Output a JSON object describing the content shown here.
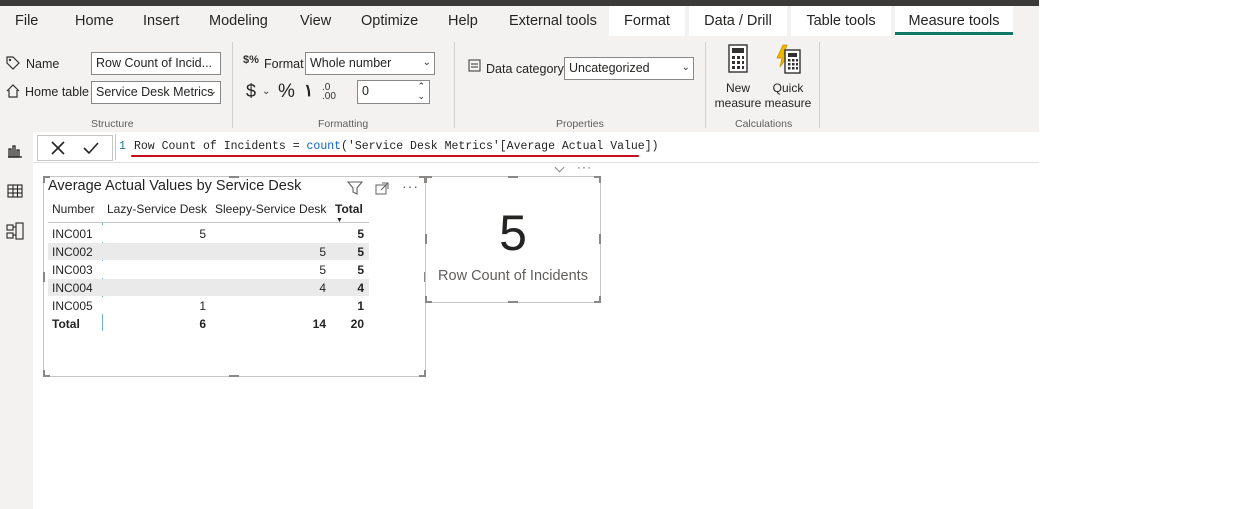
{
  "ribbon_tabs": [
    "File",
    "Home",
    "Insert",
    "Modeling",
    "View",
    "Optimize",
    "Help",
    "External tools"
  ],
  "context_tabs": [
    "Format",
    "Data / Drill",
    "Table tools",
    "Measure tools"
  ],
  "active_tab": "Measure tools",
  "structure": {
    "name_label": "Name",
    "name_value": "Row Count of Incid...",
    "home_table_label": "Home table",
    "home_table_value": "Service Desk Metrics",
    "group_label": "Structure"
  },
  "formatting": {
    "format_label": "Format",
    "format_value": "Whole number",
    "currency_symbol": "$",
    "percent_symbol": "%",
    "comma_symbol": "١",
    "decimals_value": "0",
    "group_label": "Formatting"
  },
  "properties": {
    "data_category_label": "Data category",
    "data_category_value": "Uncategorized",
    "group_label": "Properties"
  },
  "calculations": {
    "new_measure": [
      "New",
      "measure"
    ],
    "quick_measure": [
      "Quick",
      "measure"
    ],
    "group_label": "Calculations"
  },
  "formula_bar": {
    "line_number": "1",
    "measure_name": "Row Count of Incidents = ",
    "function": "count",
    "argument": "('Service Desk Metrics'[Average Actual Value])"
  },
  "matrix": {
    "title": "Average Actual Values by Service Desk",
    "headers": [
      "Number",
      "Lazy-Service Desk",
      "Sleepy-Service Desk",
      "Total"
    ],
    "rows": [
      {
        "number": "INC001",
        "lazy": "5",
        "sleepy": "",
        "total": "5"
      },
      {
        "number": "INC002",
        "lazy": "",
        "sleepy": "5",
        "total": "5"
      },
      {
        "number": "INC003",
        "lazy": "",
        "sleepy": "5",
        "total": "5"
      },
      {
        "number": "INC004",
        "lazy": "",
        "sleepy": "4",
        "total": "4"
      },
      {
        "number": "INC005",
        "lazy": "1",
        "sleepy": "",
        "total": "1"
      }
    ],
    "total_row": {
      "number": "Total",
      "lazy": "6",
      "sleepy": "14",
      "total": "20"
    }
  },
  "card": {
    "value": "5",
    "label": "Row Count of Incidents"
  },
  "colors": {
    "accent": "#117865",
    "formula_underline": "#c50f1f",
    "function_color": "#0b62c4"
  }
}
